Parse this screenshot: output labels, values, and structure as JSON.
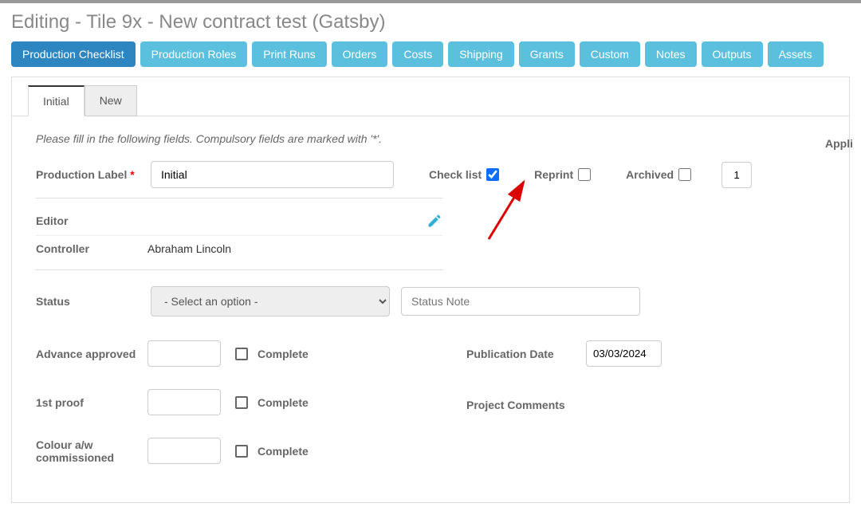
{
  "title": "Editing - Tile 9x - New contract test (Gatsby)",
  "nav": [
    {
      "label": "Production Checklist",
      "active": true
    },
    {
      "label": "Production Roles"
    },
    {
      "label": "Print Runs"
    },
    {
      "label": "Orders"
    },
    {
      "label": "Costs"
    },
    {
      "label": "Shipping"
    },
    {
      "label": "Grants"
    },
    {
      "label": "Custom"
    },
    {
      "label": "Notes"
    },
    {
      "label": "Outputs"
    },
    {
      "label": "Assets"
    }
  ],
  "tabs": {
    "initial": "Initial",
    "new": "New"
  },
  "hint": "Please fill in the following fields. Compulsory fields are marked with '*'.",
  "right_cut": "Appli",
  "fields": {
    "production_label_caption": "Production Label",
    "production_label_value": "Initial",
    "checklist_label": "Check list",
    "checklist_checked": true,
    "reprint_label": "Reprint",
    "reprint_checked": false,
    "archived_label": "Archived",
    "archived_checked": false,
    "order_value": "1",
    "editor_label": "Editor",
    "editor_value": "",
    "controller_label": "Controller",
    "controller_value": "Abraham Lincoln",
    "status_label": "Status",
    "status_value": "- Select an option -",
    "status_note_placeholder": "Status Note"
  },
  "tasks": {
    "complete_label": "Complete",
    "items": [
      {
        "label": "Advance approved",
        "value": ""
      },
      {
        "label": "1st proof",
        "value": ""
      },
      {
        "label": "Colour a/w commissioned",
        "value": ""
      }
    ]
  },
  "right": {
    "pub_date_label": "Publication Date",
    "pub_date_value": "03/03/2024",
    "comments_label": "Project Comments"
  }
}
